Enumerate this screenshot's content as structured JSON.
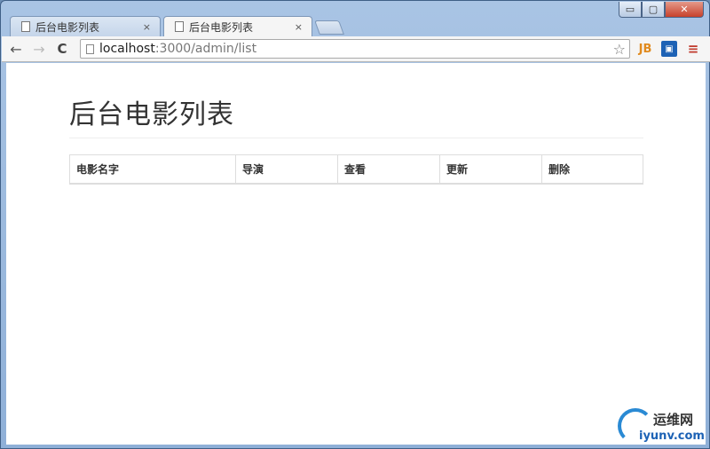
{
  "window": {
    "minimize_glyph": "▭",
    "maximize_glyph": "▢",
    "close_glyph": "✕"
  },
  "tabs": [
    {
      "label": "后台电影列表",
      "close": "×",
      "active": false
    },
    {
      "label": "后台电影列表",
      "close": "×",
      "active": true
    }
  ],
  "toolbar": {
    "back_icon": "←",
    "forward_icon": "→",
    "reload_icon": "C",
    "url_host": "localhost",
    "url_rest": ":3000/admin/list",
    "star_icon": "☆",
    "ext_jb": "JB",
    "ext_blue": "▣",
    "menu_icon": "≡"
  },
  "page": {
    "title": "后台电影列表",
    "table_headers": [
      "电影名字",
      "导演",
      "查看",
      "更新",
      "删除"
    ]
  },
  "watermark": {
    "cn": "运维网",
    "en": "iyunv.com"
  },
  "colors": {
    "accent": "#1d62b5",
    "menu": "#c0392b"
  }
}
